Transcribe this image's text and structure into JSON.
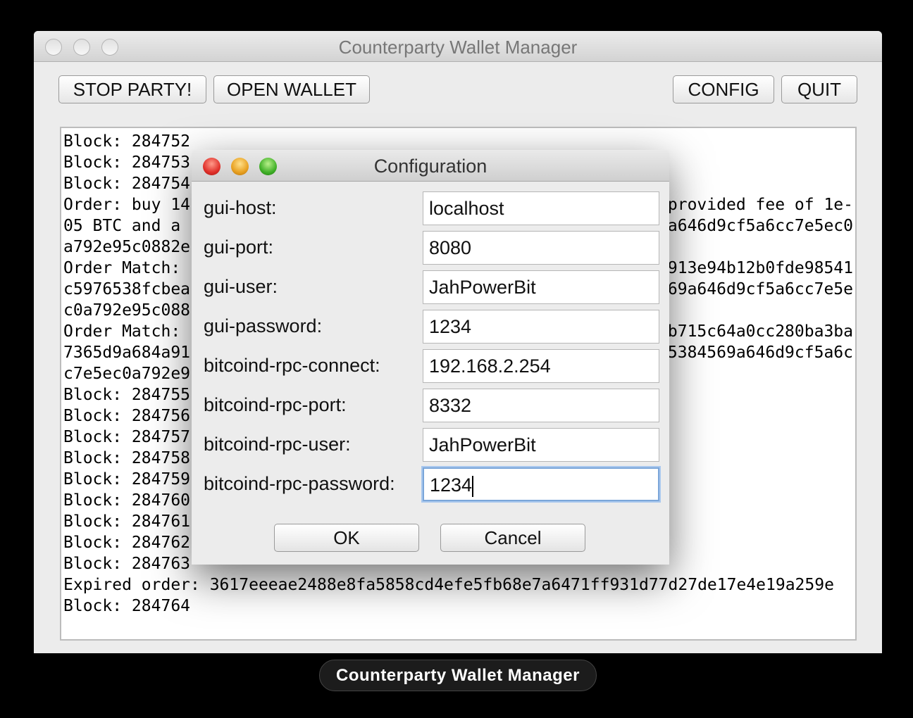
{
  "window": {
    "title": "Counterparty Wallet Manager"
  },
  "toolbar": {
    "stop": "STOP PARTY!",
    "open": "OPEN WALLET",
    "config": "CONFIG",
    "quit": "QUIT"
  },
  "log": [
    {
      "left": "Block: 284752",
      "right": ""
    },
    {
      "left": "Block: 284753",
      "right": ""
    },
    {
      "left": "Block: 284754",
      "right": ""
    },
    {
      "left": "Order: buy 14",
      "right": "provided fee of 1e-"
    },
    {
      "left": "05 BTC and a",
      "right": "a646d9cf5a6cc7e5ec0"
    },
    {
      "left": "a792e95c0882e",
      "right": ""
    },
    {
      "left": "Order Match:",
      "right": "913e94b12b0fde98541"
    },
    {
      "left": "c5976538fcbea",
      "right": "69a646d9cf5a6cc7e5e"
    },
    {
      "left": "c0a792e95c088",
      "right": ""
    },
    {
      "left": "Order Match:",
      "right": "b715c64a0cc280ba3ba"
    },
    {
      "left": "7365d9a684a91",
      "right": "5384569a646d9cf5a6c"
    },
    {
      "left": "c7e5ec0a792e9",
      "right": ""
    },
    {
      "left": "Block: 284755",
      "right": ""
    },
    {
      "left": "Block: 284756",
      "right": ""
    },
    {
      "left": "Block: 284757",
      "right": ""
    },
    {
      "left": "Block: 284758",
      "right": ""
    },
    {
      "left": "Block: 284759",
      "right": ""
    },
    {
      "left": "Block: 284760",
      "right": ""
    },
    {
      "left": "Block: 284761",
      "right": ""
    },
    {
      "left": "Block: 284762",
      "right": ""
    },
    {
      "left": "Block: 284763",
      "right": ""
    },
    {
      "left": "Expired order: 3617eeeae2488e8fa5858cd4efe5fb68e7a6471ff931d77d27de17e4e19a259e",
      "right": ""
    },
    {
      "left": "Block: 284764",
      "right": ""
    }
  ],
  "dialog": {
    "title": "Configuration",
    "fields": [
      {
        "label": "gui-host:",
        "value": "localhost"
      },
      {
        "label": "gui-port:",
        "value": "8080"
      },
      {
        "label": "gui-user:",
        "value": "JahPowerBit"
      },
      {
        "label": "gui-password:",
        "value": "1234"
      },
      {
        "label": "bitcoind-rpc-connect:",
        "value": "192.168.2.254"
      },
      {
        "label": "bitcoind-rpc-port:",
        "value": "8332"
      },
      {
        "label": "bitcoind-rpc-user:",
        "value": "JahPowerBit"
      },
      {
        "label": "bitcoind-rpc-password:",
        "value": "1234"
      }
    ],
    "ok": "OK",
    "cancel": "Cancel"
  },
  "dock_label": "Counterparty Wallet Manager"
}
